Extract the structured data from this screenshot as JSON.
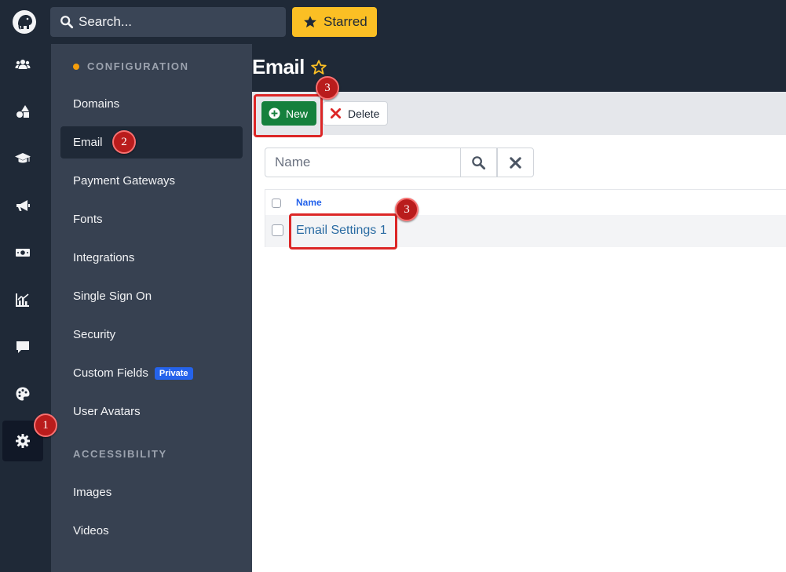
{
  "topbar": {
    "search_placeholder": "Search...",
    "starred_label": "Starred"
  },
  "rail": {
    "icons": [
      "users-icon",
      "shapes-icon",
      "graduation-cap-icon",
      "bullhorn-icon",
      "money-bill-icon",
      "chart-icon",
      "comment-icon",
      "palette-icon",
      "gear-icon"
    ],
    "active": "gear-icon"
  },
  "sidebar": {
    "section_configuration": "CONFIGURATION",
    "items": [
      {
        "label": "Domains"
      },
      {
        "label": "Email"
      },
      {
        "label": "Payment Gateways"
      },
      {
        "label": "Fonts"
      },
      {
        "label": "Integrations"
      },
      {
        "label": "Single Sign On"
      },
      {
        "label": "Security"
      },
      {
        "label": "Custom Fields",
        "badge": "Private"
      },
      {
        "label": "User Avatars"
      }
    ],
    "section_accessibility": "ACCESSIBILITY",
    "accessibility_items": [
      {
        "label": "Images"
      },
      {
        "label": "Videos"
      }
    ],
    "active_item": "Email"
  },
  "main": {
    "title": "Email",
    "toolbar": {
      "new_label": "New",
      "delete_label": "Delete"
    },
    "filter": {
      "placeholder": "Name"
    },
    "table": {
      "column_header": "Name",
      "rows": [
        {
          "name": "Email Settings 1"
        }
      ]
    }
  },
  "annotations": {
    "marker_1": "1",
    "marker_2": "2",
    "marker_3a": "3",
    "marker_3b": "3"
  },
  "colors": {
    "accent_green": "#15803d",
    "starred_yellow": "#fbbf24",
    "annotation_red": "#dc2626",
    "badge_blue": "#2563eb"
  }
}
